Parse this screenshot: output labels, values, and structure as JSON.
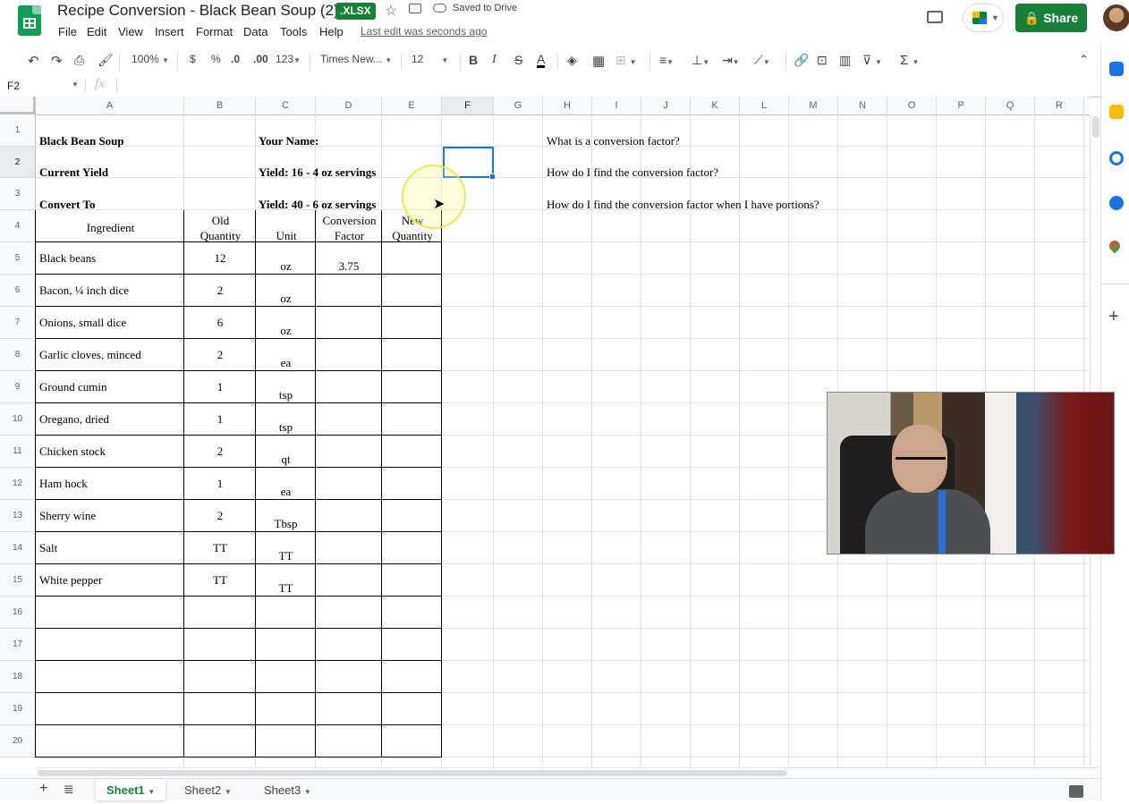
{
  "titlebar": {
    "doc_title": "Recipe Conversion - Black Bean Soup (2)",
    "file_badge": ".XLSX",
    "saved_status": "Saved to Drive",
    "last_edit": "Last edit was seconds ago",
    "share_label": "Share",
    "menu": [
      "File",
      "Edit",
      "View",
      "Insert",
      "Format",
      "Data",
      "Tools",
      "Help"
    ]
  },
  "toolbar": {
    "zoom": "100%",
    "currency": "$",
    "percent": "%",
    "dec_decrease": ".0",
    "dec_increase": ".00",
    "more_formats": "123",
    "font": "Times New...",
    "font_size": "12",
    "bold": "B",
    "italic": "I",
    "strike": "S",
    "text_color": "A"
  },
  "formula_bar": {
    "name_box": "F2",
    "fx": "fx",
    "value": ""
  },
  "grid": {
    "columns": [
      "A",
      "B",
      "C",
      "D",
      "E",
      "F",
      "G",
      "H",
      "I",
      "J",
      "K",
      "L",
      "M",
      "N",
      "O",
      "P",
      "Q",
      "R"
    ],
    "selected_column": "F",
    "selected_row": "2",
    "rows": [
      "1",
      "2",
      "3",
      "4",
      "5",
      "6",
      "7",
      "8",
      "9",
      "10",
      "11",
      "12",
      "13",
      "14",
      "15",
      "16",
      "17",
      "18",
      "19",
      "20"
    ]
  },
  "sheet": {
    "title": "Black Bean Soup",
    "your_name": "Your Name:",
    "current_yield_label": "Current Yield",
    "current_yield_value": "Yield: 16 - 4 oz servings",
    "convert_to_label": "Convert To",
    "convert_to_value": "Yield: 40 - 6 oz servings",
    "questions": [
      "What is a conversion factor?",
      "How do I find the conversion factor?",
      "How do I find the conversion factor when I have portions?"
    ],
    "headers": {
      "ingredient": "Ingredient",
      "old_qty_1": "Old",
      "old_qty_2": "Quantity",
      "unit": "Unit",
      "conv_1": "Conversion",
      "conv_2": "Factor",
      "new_1": "New",
      "new_2": "Quantity"
    },
    "ingredients": [
      {
        "name": "Black beans",
        "qty": "12",
        "unit": "oz",
        "factor": "3.75"
      },
      {
        "name": "Bacon, ¼ inch dice",
        "qty": "2",
        "unit": "oz",
        "factor": ""
      },
      {
        "name": "Onions, small dice",
        "qty": "6",
        "unit": "oz",
        "factor": ""
      },
      {
        "name": "Garlic cloves, minced",
        "qty": "2",
        "unit": "ea",
        "factor": ""
      },
      {
        "name": "Ground cumin",
        "qty": "1",
        "unit": "tsp",
        "factor": ""
      },
      {
        "name": "Oregano, dried",
        "qty": "1",
        "unit": "tsp",
        "factor": ""
      },
      {
        "name": "Chicken stock",
        "qty": "2",
        "unit": "qt",
        "factor": ""
      },
      {
        "name": "Ham hock",
        "qty": "1",
        "unit": "ea",
        "factor": ""
      },
      {
        "name": "Sherry wine",
        "qty": "2",
        "unit": "Tbsp",
        "factor": ""
      },
      {
        "name": "Salt",
        "qty": "TT",
        "unit": "TT",
        "factor": ""
      },
      {
        "name": "White pepper",
        "qty": "TT",
        "unit": "TT",
        "factor": ""
      }
    ]
  },
  "tabs": [
    "Sheet1",
    "Sheet2",
    "Sheet3"
  ],
  "active_tab": "Sheet1",
  "colors": {
    "accent_green": "#188038",
    "selection_blue": "#1a73e8"
  }
}
